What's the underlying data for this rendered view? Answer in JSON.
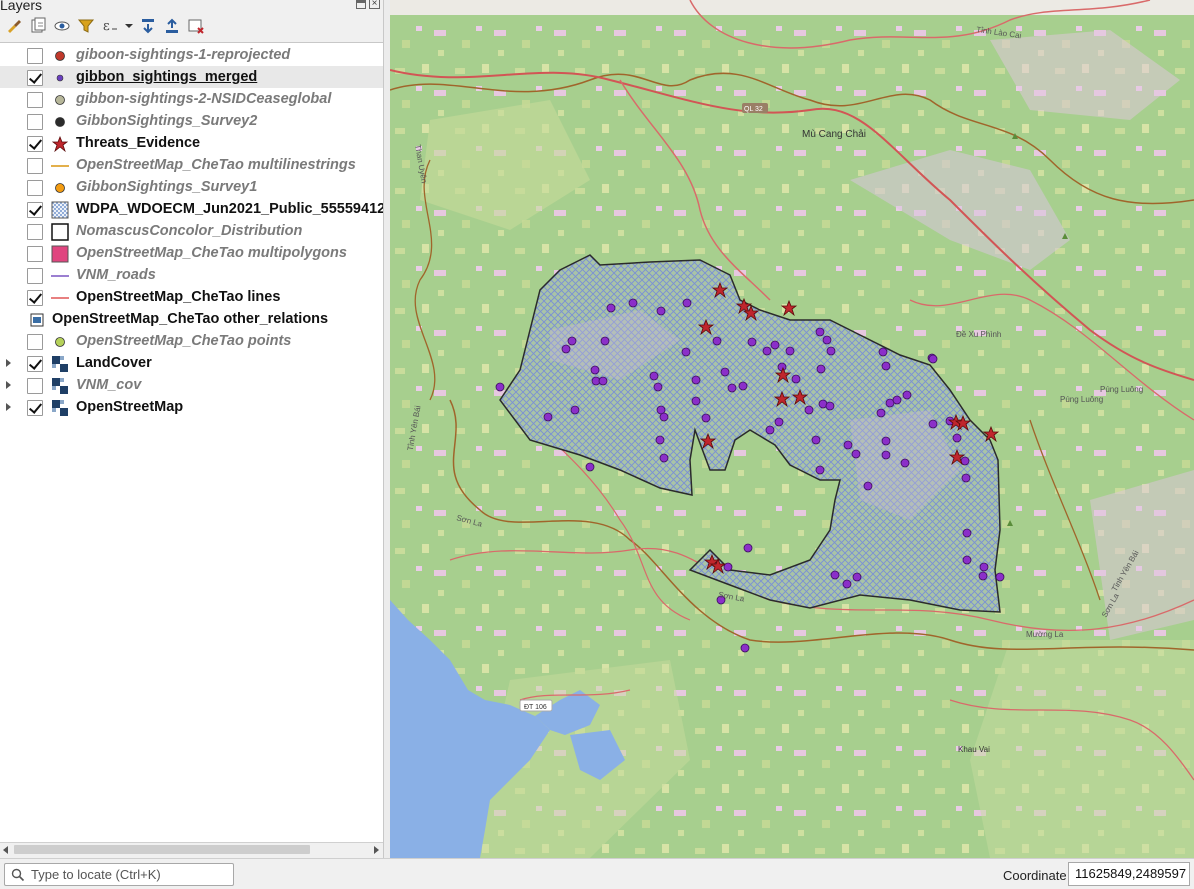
{
  "panel": {
    "title": "Layers"
  },
  "toolbar": {
    "icons": [
      "style-brush-icon",
      "add-group-icon",
      "eye-icon",
      "filter-icon",
      "expression-filter-icon",
      "expand-all-icon",
      "collapse-all-icon",
      "remove-layer-icon"
    ]
  },
  "layers": [
    {
      "label": "giboon-sightings-1-reprojected",
      "checked": false,
      "symbol": "point",
      "color": "#c0392b"
    },
    {
      "label": "gibbon_sightings_merged",
      "checked": true,
      "symbol": "point-small",
      "color": "#6a3fbf"
    },
    {
      "label": "gibbon-sightings-2-NSIDCeaseglobal",
      "checked": false,
      "symbol": "point",
      "color": "#b7b79a"
    },
    {
      "label": "GibbonSightings_Survey2",
      "checked": false,
      "symbol": "point",
      "color": "#2b2b2b"
    },
    {
      "label": "Threats_Evidence",
      "checked": true,
      "symbol": "star",
      "color": "#c0262d"
    },
    {
      "label": "OpenStreetMap_CheTao multilinestrings",
      "checked": false,
      "symbol": "line",
      "color": "#e3b04b"
    },
    {
      "label": "GibbonSightings_Survey1",
      "checked": false,
      "symbol": "point",
      "color": "#f39c12"
    },
    {
      "label": "WDPA_WDOECM_Jun2021_Public_55559412",
      "checked": true,
      "symbol": "hatch",
      "color": "#6b8fc9"
    },
    {
      "label": "NomascusConcolor_Distribution",
      "checked": false,
      "symbol": "outline",
      "color": "#111111"
    },
    {
      "label": "OpenStreetMap_CheTao multipolygons",
      "checked": false,
      "symbol": "fill",
      "color": "#e0457f"
    },
    {
      "label": "VNM_roads",
      "checked": false,
      "symbol": "line",
      "color": "#9b7fd1"
    },
    {
      "label": "OpenStreetMap_CheTao lines",
      "checked": true,
      "symbol": "line",
      "color": "#e88080"
    },
    {
      "label": "OpenStreetMap_CheTao other_relations",
      "checked": null,
      "symbol": "table",
      "color": "#3a6ea5"
    },
    {
      "label": "OpenStreetMap_CheTao points",
      "checked": false,
      "symbol": "point",
      "color": "#b5d15a"
    },
    {
      "label": "LandCover",
      "checked": true,
      "symbol": "raster",
      "color": "#1f3f66",
      "expandable": true
    },
    {
      "label": "VNM_cov",
      "checked": false,
      "symbol": "raster",
      "color": "#1f3f66",
      "expandable": true
    },
    {
      "label": "OpenStreetMap",
      "checked": true,
      "symbol": "raster",
      "color": "#1f3f66",
      "expandable": true
    }
  ],
  "map": {
    "labels": {
      "lao_cai": "Tỉnh Lào Cai",
      "ql32": "QL 32",
      "mu_cang_chai": "Mù Cang Chải",
      "than_uyen": "Than Uyên",
      "de_xu_phinh": "Đề Xu Phình",
      "pung_luong_1": "Púng Luông",
      "pung_luong_2": "Púng Luông",
      "tinh_yen_bai_left": "Tỉnh Yên Bái",
      "son_la_left": "Sơn La",
      "son_la_bottom": "Sơn La",
      "muong_la": "Mường La",
      "son_la_right": "Sơn La",
      "tinh_yen_bai_right": "Tỉnh Yên Bái",
      "dt106": "ĐT 106",
      "khau_vai": "Khau Vai"
    },
    "colors": {
      "forest": "#a7cf8e",
      "water": "#8ab0e6",
      "protected_hatch": "#6b8fc9",
      "sighting": "#8b2fc9",
      "threat": "#c0262d"
    }
  },
  "status": {
    "locator_placeholder": "Type to locate (Ctrl+K)",
    "coordinate_label": "Coordinate",
    "coordinate_value": "11625849,2489597"
  }
}
